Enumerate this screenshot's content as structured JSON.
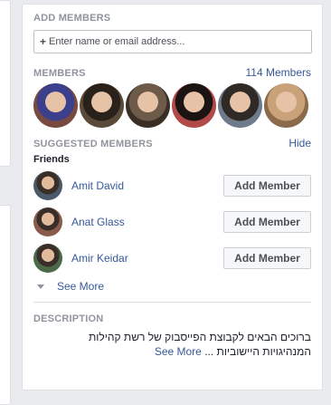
{
  "add_members": {
    "title": "ADD MEMBERS",
    "input_placeholder": "Enter name or email address..."
  },
  "members": {
    "title": "MEMBERS",
    "count_link": "114 Members",
    "avatars": [
      {
        "bg": "#7a4a3e",
        "accent": "#3b3f8c"
      },
      {
        "bg": "#5a4a3a",
        "accent": "#2a211b"
      },
      {
        "bg": "#3a2f26",
        "accent": "#6e5a48"
      },
      {
        "bg": "#b24a4a",
        "accent": "#1c1412"
      },
      {
        "bg": "#6f7a8a",
        "accent": "#2f2a25"
      },
      {
        "bg": "#8a6a4a",
        "accent": "#c9a27a"
      }
    ]
  },
  "suggested": {
    "title": "SUGGESTED MEMBERS",
    "hide_link": "Hide",
    "friends_label": "Friends",
    "items": [
      {
        "name": "Amit David",
        "button": "Add Member",
        "bg": "#4a5a6a"
      },
      {
        "name": "Anat Glass",
        "button": "Add Member",
        "bg": "#8a5a4a"
      },
      {
        "name": "Amir Keidar",
        "button": "Add Member",
        "bg": "#4a6a4a"
      }
    ],
    "see_more": "See More"
  },
  "description": {
    "title": "DESCRIPTION",
    "line1": "ברוכים הבאים לקבוצת הפייסבוק של רשת קהילות",
    "line2": "המנהיגויות היישוביות ...",
    "see_more": "See More"
  },
  "colors": {
    "link": "#365899",
    "muted": "#90949c",
    "border": "#dddfe2"
  }
}
